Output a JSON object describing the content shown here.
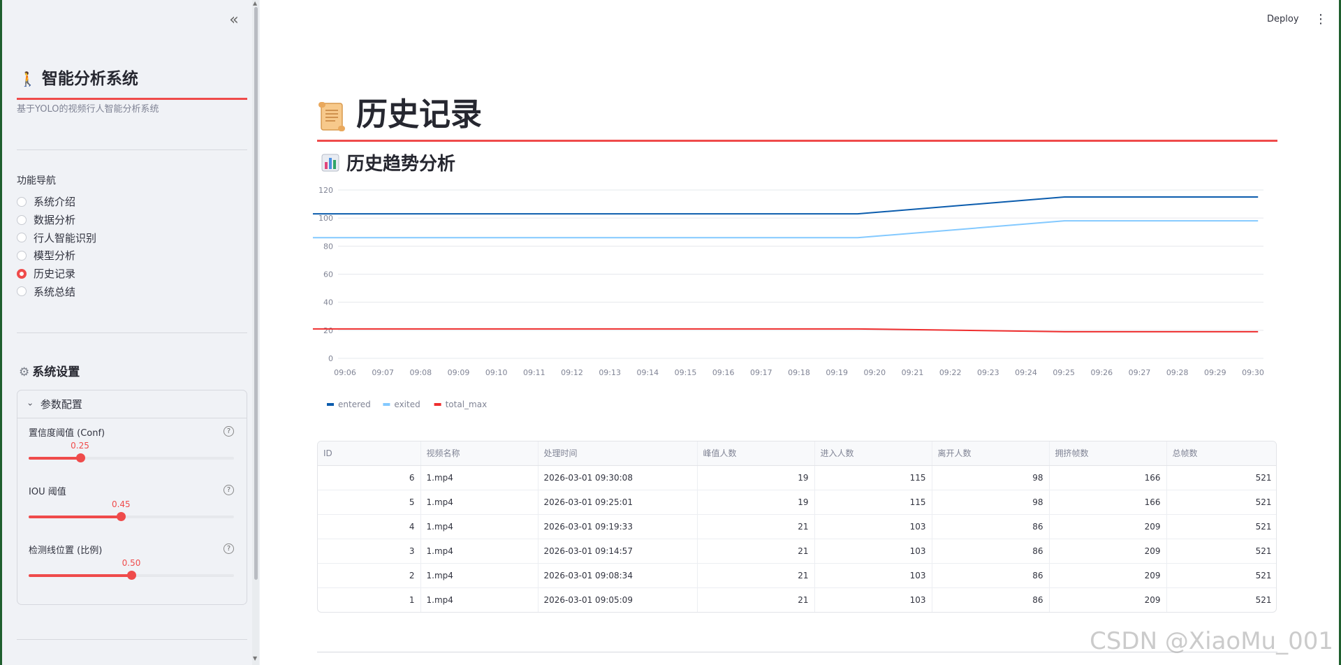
{
  "sidebar": {
    "collapse_icon": "double-chevron-left-icon",
    "brand_emoji": "🚶",
    "brand_title": "智能分析系统",
    "brand_subtitle": "基于YOLO的视频行人智能分析系统",
    "nav_label": "功能导航",
    "nav_items": [
      {
        "label": "系统介绍",
        "selected": false
      },
      {
        "label": "数据分析",
        "selected": false
      },
      {
        "label": "行人智能识别",
        "selected": false
      },
      {
        "label": "模型分析",
        "selected": false
      },
      {
        "label": "历史记录",
        "selected": true
      },
      {
        "label": "系统总结",
        "selected": false
      }
    ],
    "settings_icon": "gear-icon",
    "settings_title": "系统设置",
    "expander_label": "参数配置",
    "sliders": [
      {
        "label": "置信度阈值 (Conf)",
        "value": "0.25",
        "fraction": 0.25
      },
      {
        "label": "IOU 阈值",
        "value": "0.45",
        "fraction": 0.45
      },
      {
        "label": "检测线位置 (比例)",
        "value": "0.50",
        "fraction": 0.5
      }
    ],
    "help_glyph": "?"
  },
  "header": {
    "deploy_label": "Deploy",
    "menu_icon": "kebab-menu-icon",
    "menu_glyph": "⋮"
  },
  "main": {
    "title": "历史记录",
    "title_icon": "scroll-icon",
    "subtitle": "历史趋势分析",
    "subtitle_icon": "bar-chart-icon"
  },
  "chart_data": {
    "type": "line",
    "x": [
      "09:06",
      "09:07",
      "09:08",
      "09:09",
      "09:10",
      "09:11",
      "09:12",
      "09:13",
      "09:14",
      "09:15",
      "09:16",
      "09:17",
      "09:18",
      "09:19",
      "09:20",
      "09:21",
      "09:22",
      "09:23",
      "09:24",
      "09:25",
      "09:26",
      "09:27",
      "09:28",
      "09:29",
      "09:30"
    ],
    "points_x": [
      "09:05:09",
      "09:08:34",
      "09:14:57",
      "09:19:33",
      "09:25:01",
      "09:30:08"
    ],
    "series": [
      {
        "name": "entered",
        "color": "#0b5cad",
        "values": [
          103,
          103,
          103,
          103,
          115,
          115
        ]
      },
      {
        "name": "exited",
        "color": "#83c9ff",
        "values": [
          86,
          86,
          86,
          86,
          98,
          98
        ]
      },
      {
        "name": "total_max",
        "color": "#ef2e2e",
        "values": [
          21,
          21,
          21,
          21,
          19,
          19
        ]
      }
    ],
    "yticks": [
      0,
      20,
      40,
      60,
      80,
      100,
      120
    ],
    "ylim": [
      0,
      120
    ],
    "grid": true,
    "legend_position": "bottom-left"
  },
  "table": {
    "headers": [
      "ID",
      "视频名称",
      "处理时间",
      "峰值人数",
      "进入人数",
      "离开人数",
      "拥挤帧数",
      "总帧数"
    ],
    "rows": [
      [
        "6",
        "1.mp4",
        "2026-03-01 09:30:08",
        "19",
        "115",
        "98",
        "166",
        "521"
      ],
      [
        "5",
        "1.mp4",
        "2026-03-01 09:25:01",
        "19",
        "115",
        "98",
        "166",
        "521"
      ],
      [
        "4",
        "1.mp4",
        "2026-03-01 09:19:33",
        "21",
        "103",
        "86",
        "209",
        "521"
      ],
      [
        "3",
        "1.mp4",
        "2026-03-01 09:14:57",
        "21",
        "103",
        "86",
        "209",
        "521"
      ],
      [
        "2",
        "1.mp4",
        "2026-03-01 09:08:34",
        "21",
        "103",
        "86",
        "209",
        "521"
      ],
      [
        "1",
        "1.mp4",
        "2026-03-01 09:05:09",
        "21",
        "103",
        "86",
        "209",
        "521"
      ]
    ]
  },
  "watermark": "CSDN @XiaoMu_001"
}
